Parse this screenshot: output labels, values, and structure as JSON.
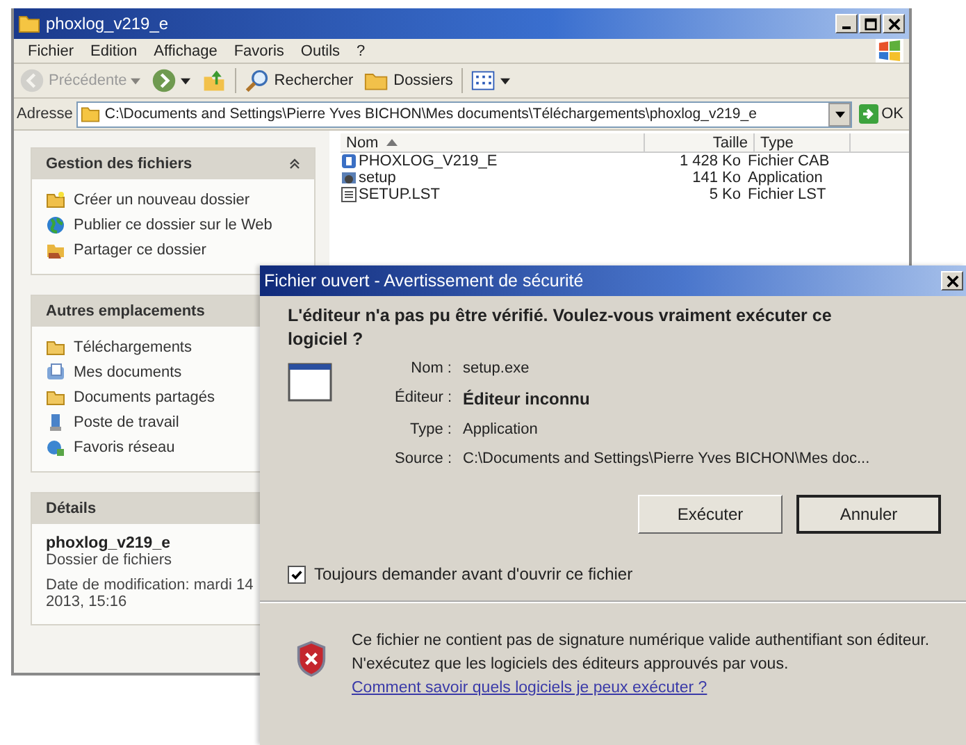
{
  "explorer": {
    "title": "phoxlog_v219_e",
    "menu": [
      "Fichier",
      "Edition",
      "Affichage",
      "Favoris",
      "Outils",
      "?"
    ],
    "toolbar": [
      {
        "kind": "back",
        "label": "Précédente",
        "disabled": true
      },
      {
        "kind": "forward",
        "disabled": false
      },
      {
        "kind": "up",
        "disabled": false
      },
      {
        "kind": "search",
        "label": "Rechercher",
        "disabled": false
      },
      {
        "kind": "folders",
        "label": "Dossiers",
        "disabled": false
      },
      {
        "kind": "views",
        "disabled": false
      }
    ],
    "address": {
      "label": "Adresse",
      "value": "C:\\Documents and Settings\\Pierre Yves BICHON\\Mes documents\\Téléchargements\\phoxlog_v219_e",
      "go": "OK"
    },
    "panels": [
      {
        "title": "Gestion des fichiers",
        "expanded": true,
        "items": [
          {
            "kind": "new-folder",
            "label": "Créer un nouveau dossier"
          },
          {
            "kind": "globe",
            "label": "Publier ce dossier sur le Web"
          },
          {
            "kind": "share",
            "label": "Partager ce dossier"
          }
        ]
      },
      {
        "title": "Autres emplacements",
        "items": [
          {
            "kind": "folder",
            "label": "Téléchargements"
          },
          {
            "kind": "documents",
            "label": "Mes documents"
          },
          {
            "kind": "folder",
            "label": "Documents partagés"
          },
          {
            "kind": "computer",
            "label": "Poste de travail"
          },
          {
            "kind": "network",
            "label": "Favoris réseau"
          }
        ]
      }
    ],
    "details": {
      "title": "Détails",
      "name": "phoxlog_v219_e",
      "type": "Dossier de fichiers",
      "modified": [
        "Date de modification: mardi 14",
        "2013, 15:16"
      ]
    },
    "columns": [
      "Nom",
      "Taille",
      "Type"
    ],
    "files": [
      {
        "kind": "cab",
        "name": "PHOXLOG_V219_E",
        "size": "1 428 Ko",
        "type": "Fichier CAB"
      },
      {
        "kind": "app",
        "name": "setup",
        "size": "141 Ko",
        "type": "Application"
      },
      {
        "kind": "text",
        "name": "SETUP.LST",
        "size": "5 Ko",
        "type": "Fichier LST"
      }
    ]
  },
  "dialog": {
    "title": "Fichier ouvert - Avertissement de sécurité",
    "question": "L'éditeur n'a pas pu être vérifié. Voulez-vous vraiment exécuter ce logiciel ?",
    "fields": [
      {
        "label": "Nom :",
        "value": "setup.exe",
        "bold": false
      },
      {
        "label": "Éditeur :",
        "value": "Éditeur inconnu",
        "bold": true
      },
      {
        "label": "Type :",
        "value": "Application",
        "bold": false
      },
      {
        "label": "Source :",
        "value": "C:\\Documents and Settings\\Pierre Yves BICHON\\Mes doc...",
        "bold": false
      }
    ],
    "buttons": [
      {
        "label": "Exécuter",
        "default": false
      },
      {
        "label": "Annuler",
        "default": true
      }
    ],
    "checkbox": {
      "label": "Toujours demander avant d'ouvrir ce fichier",
      "checked": true
    },
    "warning": "Ce fichier ne contient pas de signature numérique valide authentifiant son éditeur. N'exécutez que les logiciels des éditeurs approuvés par vous.",
    "link": "Comment savoir quels logiciels je peux exécuter ?"
  }
}
